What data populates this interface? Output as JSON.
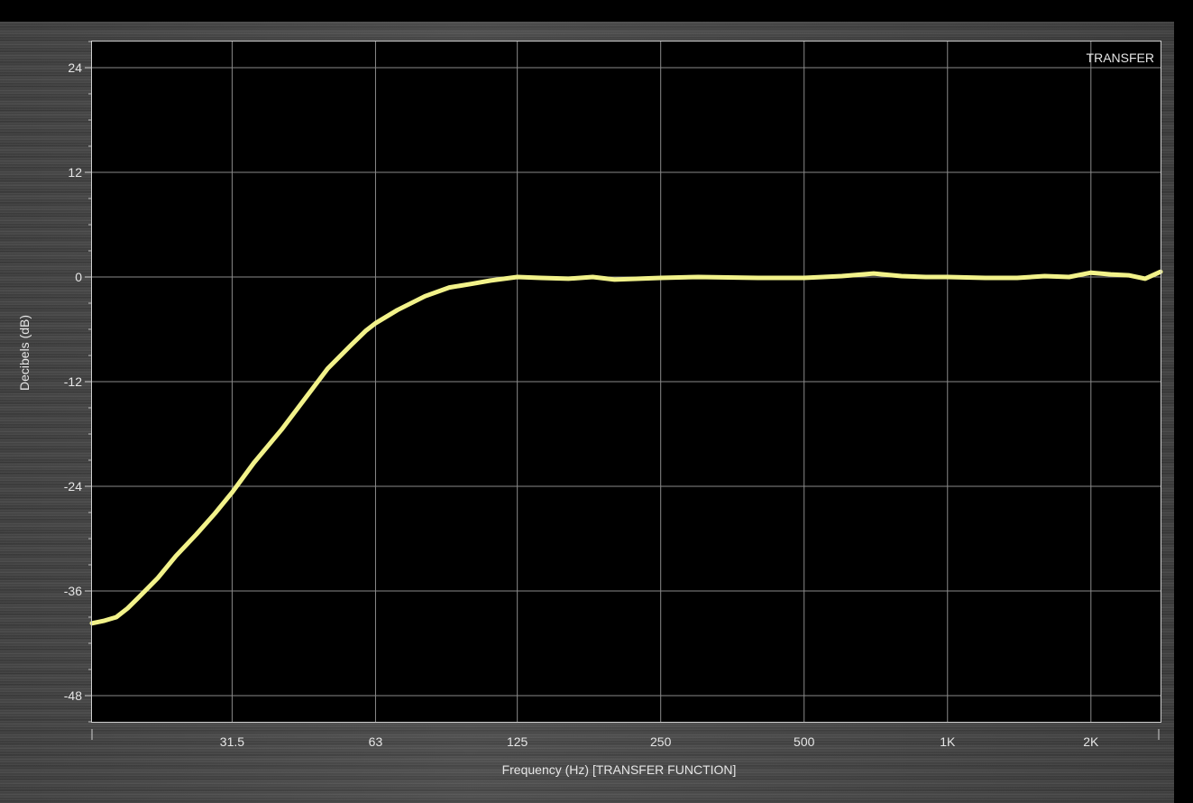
{
  "chart_data": {
    "type": "line",
    "title": "",
    "legend": "TRANSFER",
    "xlabel": "Frequency (Hz) [TRANSFER FUNCTION]",
    "ylabel": "Decibels (dB)",
    "x_scale": "log",
    "xlim": [
      16,
      2800
    ],
    "ylim": [
      -51,
      27
    ],
    "x_ticks": [
      {
        "value": 31.5,
        "label": "31.5"
      },
      {
        "value": 63,
        "label": "63"
      },
      {
        "value": 125,
        "label": "125"
      },
      {
        "value": 250,
        "label": "250"
      },
      {
        "value": 500,
        "label": "500"
      },
      {
        "value": 1000,
        "label": "1K"
      },
      {
        "value": 2000,
        "label": "2K"
      }
    ],
    "y_ticks": [
      {
        "value": 24,
        "label": "24"
      },
      {
        "value": 12,
        "label": "12"
      },
      {
        "value": 0,
        "label": "0"
      },
      {
        "value": -12,
        "label": "-12"
      },
      {
        "value": -24,
        "label": "-24"
      },
      {
        "value": -36,
        "label": "-36"
      },
      {
        "value": -48,
        "label": "-48"
      }
    ],
    "grid": true,
    "series": [
      {
        "name": "TRANSFER",
        "color": "#f2f28a",
        "x": [
          16,
          17,
          18,
          19,
          20,
          22,
          24,
          26.5,
          29,
          31.5,
          35,
          40,
          45,
          50,
          56,
          60,
          63,
          70,
          80,
          90,
          100,
          110,
          125,
          140,
          160,
          180,
          200,
          250,
          300,
          400,
          500,
          600,
          700,
          800,
          900,
          1000,
          1200,
          1400,
          1600,
          1800,
          2000,
          2200,
          2400,
          2600,
          2800
        ],
        "y": [
          -39.7,
          -39.4,
          -39.0,
          -38.0,
          -36.8,
          -34.5,
          -32.0,
          -29.5,
          -27.1,
          -24.7,
          -21.3,
          -17.5,
          -13.8,
          -10.5,
          -7.8,
          -6.2,
          -5.3,
          -3.8,
          -2.2,
          -1.2,
          -0.8,
          -0.4,
          0.0,
          -0.1,
          -0.2,
          0.0,
          -0.3,
          -0.1,
          0.0,
          -0.1,
          -0.1,
          0.1,
          0.4,
          0.1,
          0.0,
          0.0,
          -0.1,
          -0.1,
          0.1,
          0.0,
          0.5,
          0.3,
          0.2,
          -0.2,
          0.6
        ]
      }
    ]
  },
  "colors": {
    "plot_background": "#000000",
    "grid": "#8a8a8a",
    "trace": "#f2f28a",
    "text": "#e6e6e6"
  }
}
